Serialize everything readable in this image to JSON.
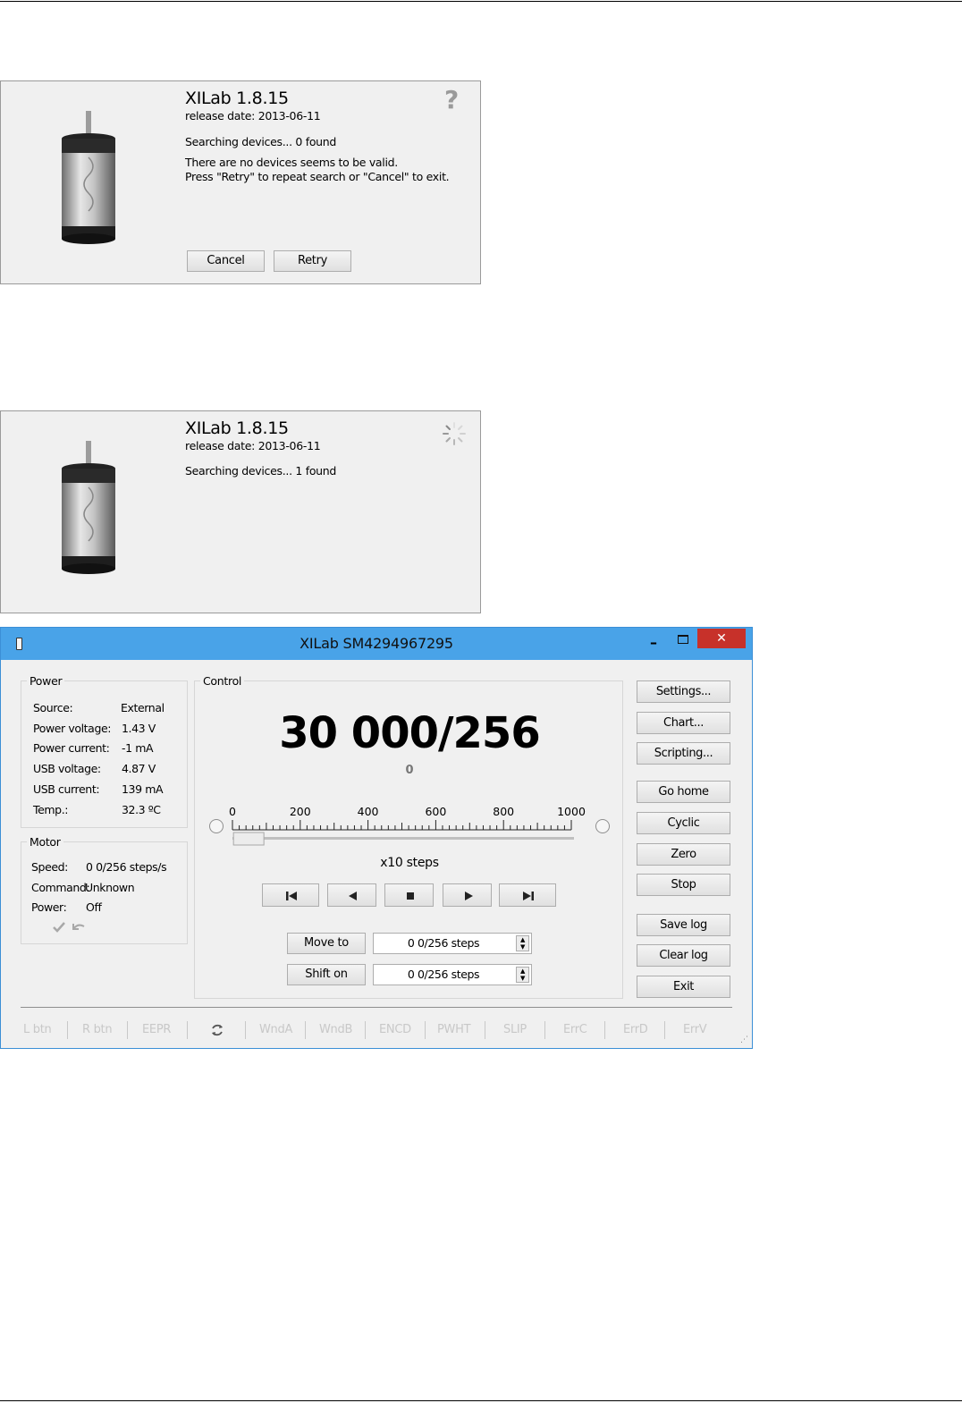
{
  "splash1": {
    "title": "XILab 1.8.15",
    "release": "release date: 2013-06-11",
    "search_status": "Searching devices... 0 found",
    "message_line1": "There are no devices seems to be valid.",
    "message_line2": "Press \"Retry\" to repeat search or \"Cancel\" to exit.",
    "help_glyph": "?",
    "cancel_label": "Cancel",
    "retry_label": "Retry"
  },
  "splash2": {
    "title": "XILab 1.8.15",
    "release": "release date: 2013-06-11",
    "search_status": "Searching devices... 1 found"
  },
  "window": {
    "title": "XILab SM4294967295",
    "min_glyph": "–",
    "close_glyph": "✕",
    "accent": "#49a3e8",
    "close_color": "#c7312a"
  },
  "power": {
    "title": "Power",
    "rows": [
      {
        "label": "Source:",
        "value": "External"
      },
      {
        "label": "Power voltage:",
        "value": "1.43 V"
      },
      {
        "label": "Power current:",
        "value": "-1 mA"
      },
      {
        "label": "USB voltage:",
        "value": "4.87 V"
      },
      {
        "label": "USB current:",
        "value": "139 mA"
      },
      {
        "label": "Temp.:",
        "value": "32.3 ºC"
      }
    ]
  },
  "motor": {
    "title": "Motor",
    "speed_label": "Speed:",
    "speed_value": "0 0/256 steps/s",
    "command_label": "Command:",
    "command_value": "Unknown",
    "power_label": "Power:",
    "power_value": "Off",
    "icons": [
      "check-icon",
      "undo-icon"
    ]
  },
  "control": {
    "title": "Control",
    "position": "30 000/256",
    "encoder": "0",
    "scale_ticks": [
      "0",
      "200",
      "400",
      "600",
      "800",
      "1000"
    ],
    "units": "x10  steps",
    "slider_level": 0.04,
    "nav_icons": [
      "skip-to-start-icon",
      "left-icon",
      "stop-icon",
      "right-icon",
      "skip-to-end-icon"
    ],
    "move_to_label": "Move to",
    "move_to_value": "0 0/256 steps",
    "shift_on_label": "Shift on",
    "shift_on_value": "0 0/256 steps"
  },
  "right_buttons": {
    "settings": "Settings...",
    "chart": "Chart...",
    "scripting": "Scripting...",
    "go_home": "Go home",
    "cyclic": "Cyclic",
    "zero": "Zero",
    "stop": "Stop",
    "save_log": "Save log",
    "clear_log": "Clear log",
    "exit": "Exit"
  },
  "statusbar": [
    "L btn",
    "R btn",
    "EEPR",
    "WndA",
    "WndB",
    "ENCD",
    "PWHT",
    "SLIP",
    "ErrC",
    "ErrD",
    "ErrV"
  ]
}
